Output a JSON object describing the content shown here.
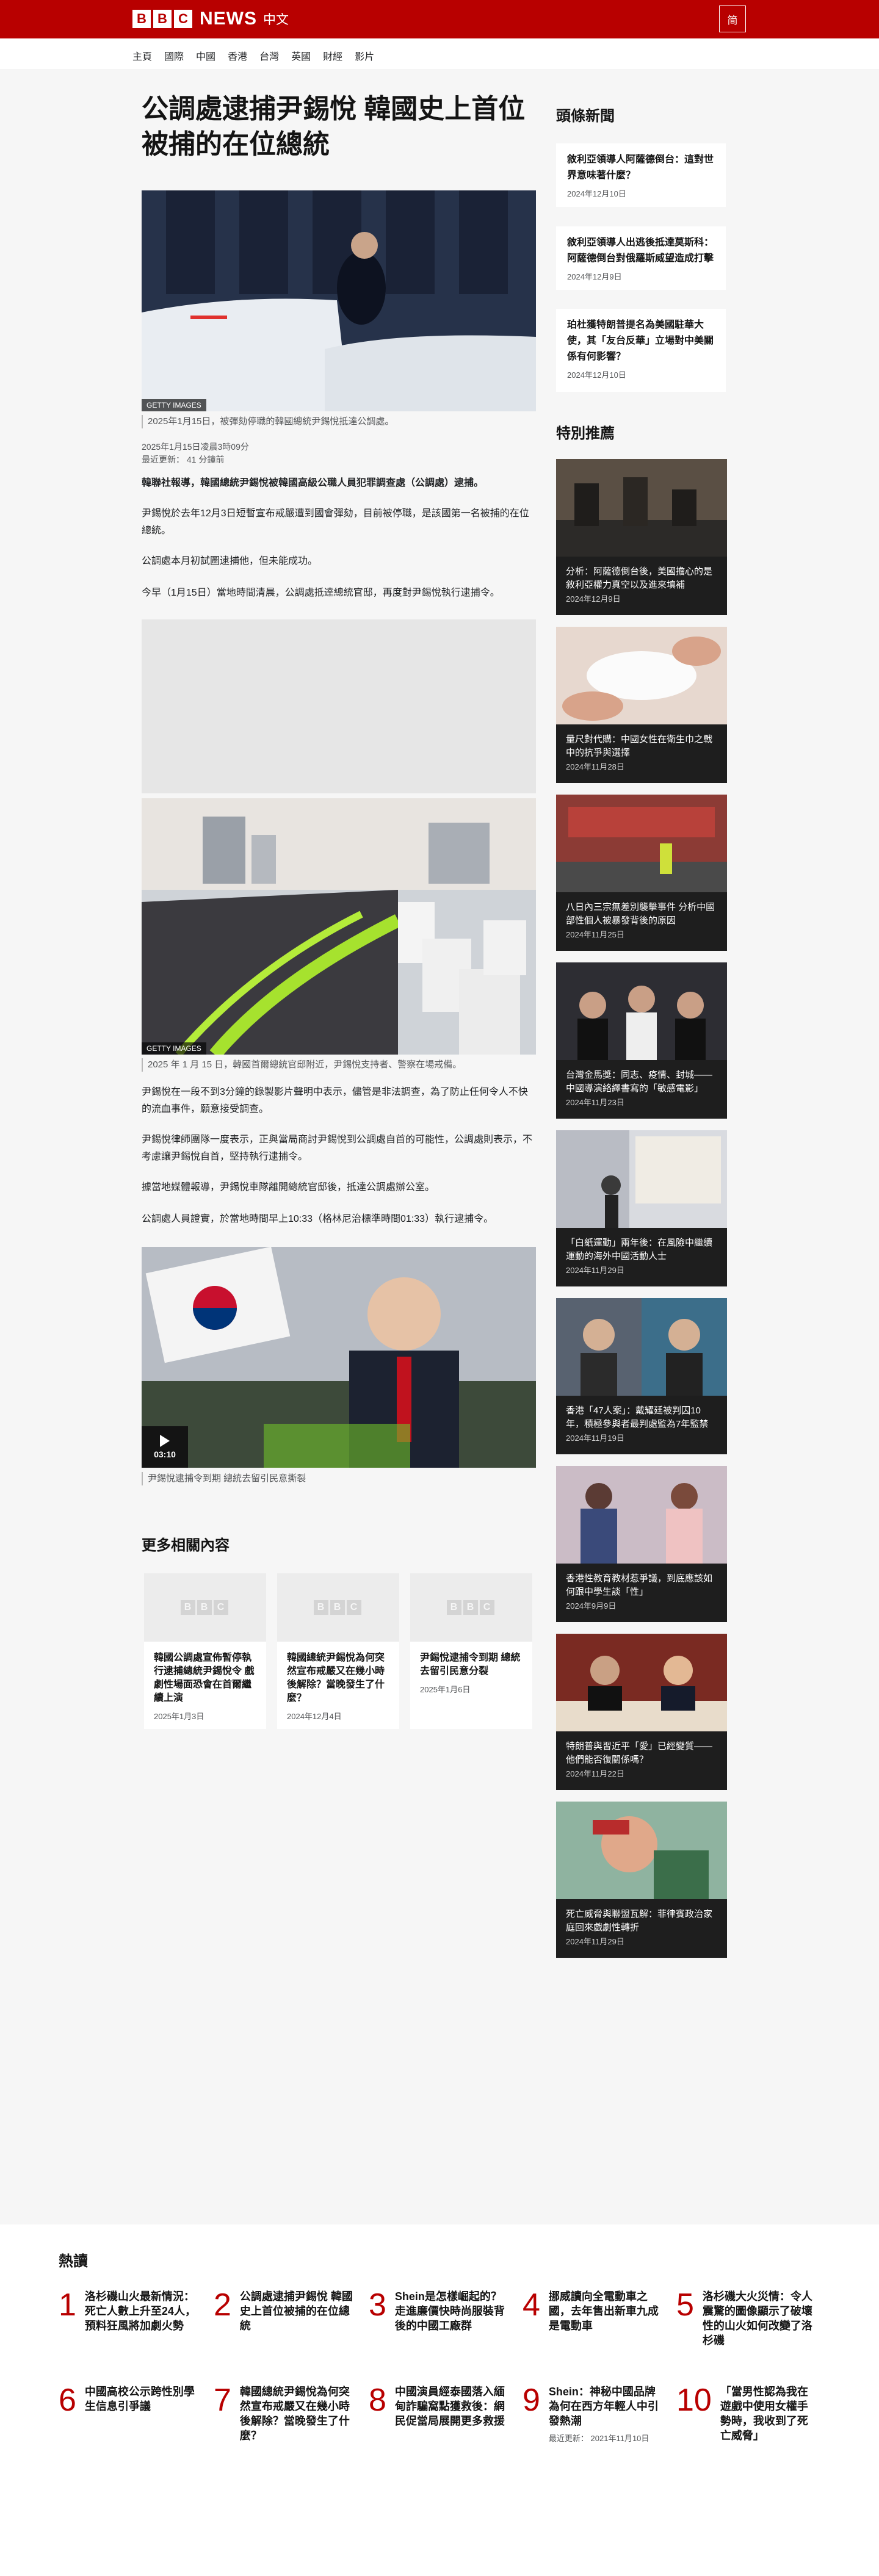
{
  "header": {
    "logo_letters": [
      "B",
      "B",
      "C"
    ],
    "news_label": "NEWS",
    "zh_label": "中文",
    "lang_toggle": "简"
  },
  "nav": {
    "items": [
      "主頁",
      "國際",
      "中國",
      "香港",
      "台灣",
      "英國",
      "財經",
      "影片"
    ]
  },
  "article": {
    "headline": "公調處逮捕尹錫悅 韓國史上首位被捕的在位總統",
    "hero_credit": "GETTY IMAGES",
    "hero_caption": "2025年1月15日，被彈劾停職的韓國總統尹錫悅抵達公調處。",
    "published": "2025年1月15日凌晨3時09分",
    "updated": "最近更新： 41 分鐘前",
    "lead": "韓聯社報導，韓國總統尹錫悅被韓國高級公職人員犯罪調查處（公調處）逮捕。",
    "paragraphs_1": [
      "尹錫悅於去年12月3日短暫宣布戒嚴遭到國會彈劾，目前被停職，是該國第一名被捕的在位總統。",
      "公調處本月初試圖逮捕他，但未能成功。",
      "今早（1月15日）當地時間清晨，公調處抵達總統官邸，再度對尹錫悅執行逮捕令。"
    ],
    "crowd_credit": "GETTY IMAGES",
    "crowd_caption": "2025 年 1 月 15 日，韓國首爾總統官邸附近，尹錫悅支持者、警察在場戒備。",
    "paragraphs_2": [
      "尹錫悅在一段不到3分鐘的錄製影片聲明中表示，儘管是非法調查，為了防止任何令人不快的流血事件，願意接受調查。",
      "尹錫悅律師團隊一度表示，正與當局商討尹錫悅到公調處自首的可能性，公調處則表示，不考慮讓尹錫悅自首，堅持執行逮捕令。",
      "據當地媒體報導，尹錫悅車隊離開總統官邸後，抵達公調處辦公室。",
      "公調處人員證實，於當地時間早上10:33（格林尼治標準時間01:33）執行逮捕令。"
    ],
    "video_duration": "03:10",
    "video_caption": "尹錫悅逮捕令到期 總統去留引民意撕裂"
  },
  "related": {
    "title": "更多相關內容",
    "items": [
      {
        "title": "韓國公調處宣佈暫停執行逮捕總統尹錫悅令 戲劇性場面恐會在首爾繼續上演",
        "date": "2025年1月3日"
      },
      {
        "title": "韓國總統尹錫悅為何突然宣布戒嚴又在幾小時後解除？當晚發生了什麼？",
        "date": "2024年12月4日"
      },
      {
        "title": "尹錫悅逮捕令到期 總統去留引民意分裂",
        "date": "2025年1月6日"
      }
    ]
  },
  "sidebar": {
    "top_title": "頭條新聞",
    "top_stories": [
      {
        "title": "敘利亞領導人阿薩德倒台：這對世界意味著什麼？",
        "date": "2024年12月10日"
      },
      {
        "title": "敘利亞領導人出逃後抵達莫斯科：阿薩德倒台對俄羅斯威望造成打擊",
        "date": "2024年12月9日"
      },
      {
        "title": "珀杜獲特朗普提名為美國駐華大使，其「友台反華」立場對中美關係有何影響？",
        "date": "2024年12月10日"
      }
    ],
    "featured_title": "特別推薦",
    "featured": [
      {
        "title": "分析：阿薩德倒台後，美國擔心的是敘利亞權力真空以及進來填補",
        "date": "2024年12月9日"
      },
      {
        "title": "量尺對代購：中國女性在衛生巾之戰中的抗爭與選擇",
        "date": "2024年11月28日"
      },
      {
        "title": "八日內三宗無差別襲擊事件 分析中國部性個人被暴發背後的原因",
        "date": "2024年11月25日"
      },
      {
        "title": "台灣金馬獎：同志、疫情、封城——中國導演絡繹書寫的「敏感電影」",
        "date": "2024年11月23日"
      },
      {
        "title": "「白紙運動」兩年後：在風險中繼續運動的海外中國活動人士",
        "date": "2024年11月29日"
      },
      {
        "title": "香港「47人案」：戴耀廷被判囚10年，積極參與者最判處監為7年監禁",
        "date": "2024年11月19日"
      },
      {
        "title": "香港性教育教材惹爭議，到底應該如何跟中學生談「性」",
        "date": "2024年9月9日"
      },
      {
        "title": "特朗普與習近平「愛」已經變質——他們能否復關係嗎？",
        "date": "2024年11月22日"
      },
      {
        "title": "死亡威脅與聯盟瓦解：菲律賓政治家庭回來戲劇性轉折",
        "date": "2024年11月29日"
      }
    ]
  },
  "popular": {
    "title": "熱讀",
    "items": [
      {
        "num": "1",
        "title": "洛杉磯山火最新情況：死亡人數上升至24人，預料狂風將加劇火勢",
        "date": ""
      },
      {
        "num": "2",
        "title": "公調處逮捕尹錫悅 韓國史上首位被捕的在位總統",
        "date": ""
      },
      {
        "num": "3",
        "title": "Shein是怎樣崛起的？走進廉價快時尚服裝背後的中國工廠群",
        "date": ""
      },
      {
        "num": "4",
        "title": "挪威讀向全電動車之國，去年售出新車九成是電動車",
        "date": ""
      },
      {
        "num": "5",
        "title": "洛杉磯大火災情：令人震驚的圖像顯示了破壞性的山火如何改變了洛杉磯",
        "date": ""
      },
      {
        "num": "6",
        "title": "中國高校公示跨性別學生信息引爭議",
        "date": ""
      },
      {
        "num": "7",
        "title": "韓國總統尹錫悅為何突然宣布戒嚴又在幾小時後解除？當晚發生了什麼？",
        "date": ""
      },
      {
        "num": "8",
        "title": "中國演員經泰國落入緬甸詐騙窩點獲救後：網民促當局展開更多救援",
        "date": ""
      },
      {
        "num": "9",
        "title": "Shein：神秘中國品牌為何在西方年輕人中引發熱潮",
        "date": "最近更新： 2021年11月10日"
      },
      {
        "num": "10",
        "title": "「當男性認為我在遊戲中使用女權手勢時，我收到了死亡威脅」",
        "date": ""
      }
    ]
  },
  "colors": {
    "brand_red": "#b80000",
    "page_gray": "#f6f6f6",
    "card_dark": "#1e1e1e"
  }
}
